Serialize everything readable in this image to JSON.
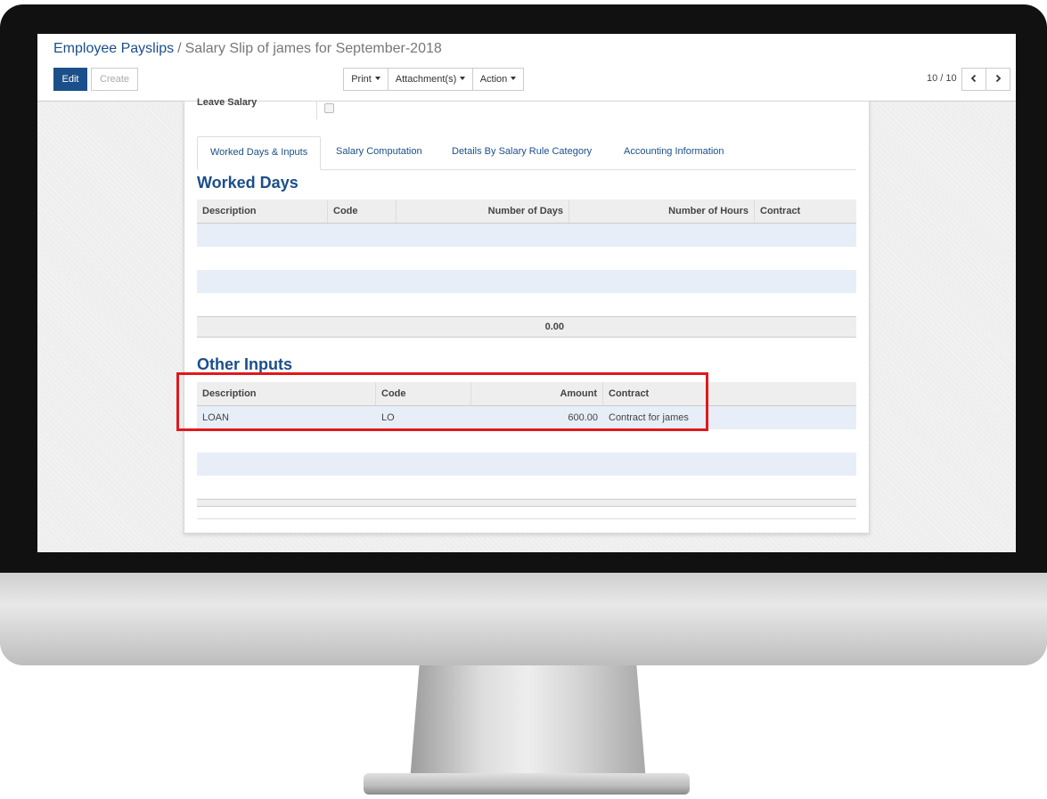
{
  "breadcrumb": {
    "parent": "Employee Payslips",
    "separator": "/",
    "current": "Salary Slip of james for September-2018"
  },
  "toolbar": {
    "edit_label": "Edit",
    "create_label": "Create",
    "print_label": "Print",
    "attachments_label": "Attachment(s)",
    "action_label": "Action"
  },
  "pager": {
    "value": "10 / 10",
    "prev_icon": "chevron-left-icon",
    "next_icon": "chevron-right-icon"
  },
  "form": {
    "leave_salary_label": "Leave Salary",
    "leave_salary_checked": false
  },
  "tabs": [
    {
      "label": "Worked Days & Inputs",
      "active": true
    },
    {
      "label": "Salary Computation"
    },
    {
      "label": "Details By Salary Rule Category"
    },
    {
      "label": "Accounting Information"
    }
  ],
  "worked_days": {
    "title": "Worked Days",
    "columns": [
      "Description",
      "Code",
      "Number of Days",
      "Number of Hours",
      "Contract"
    ],
    "rows": [],
    "total_days": "0.00"
  },
  "other_inputs": {
    "title": "Other Inputs",
    "columns": [
      "Description",
      "Code",
      "Amount",
      "Contract"
    ],
    "rows": [
      {
        "description": "LOAN",
        "code": "LO",
        "amount": "600.00",
        "contract": "Contract for james"
      }
    ]
  },
  "colors": {
    "brand": "#1b4f8a",
    "highlight": "#e0191b",
    "row_alt": "#e8eef7"
  }
}
